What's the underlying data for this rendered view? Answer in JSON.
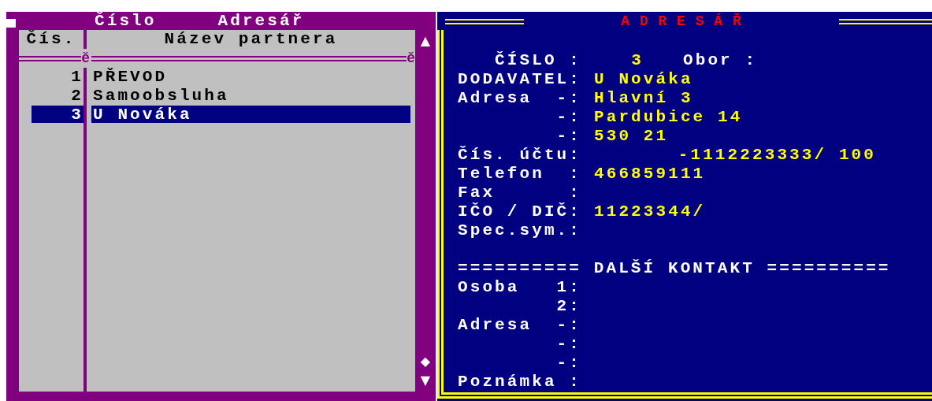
{
  "left_panel": {
    "titles": [
      "Číslo",
      "Adresář"
    ],
    "columns": [
      "Čís.",
      "Název partnera"
    ],
    "separator_marks": [
      "ě",
      "ě"
    ],
    "rows": [
      {
        "number": "1",
        "name": "PŘEVOD",
        "selected": false
      },
      {
        "number": "2",
        "name": "Samoobsluha",
        "selected": false
      },
      {
        "number": "3",
        "name": "U Nováka",
        "selected": true
      }
    ],
    "scrollbar": {
      "up": "▲",
      "thumb": "◆",
      "down": "▼"
    }
  },
  "right_panel": {
    "title": "A D R E S Á Ř",
    "fields": [
      {
        "kind": "number",
        "label": "ČÍSLO :",
        "value": "3",
        "extra_label": "Obor :"
      },
      {
        "kind": "text",
        "label": "DODAVATEL:",
        "value": "U Nováka"
      },
      {
        "kind": "text",
        "label": "Adresa  -:",
        "value": "Hlavní 3"
      },
      {
        "kind": "text",
        "label": "-:",
        "value": "Pardubice 14"
      },
      {
        "kind": "text",
        "label": "-:",
        "value": "530 21"
      },
      {
        "kind": "account",
        "label": "Čís. účtu:",
        "value": "-1112223333/ 100"
      },
      {
        "kind": "text",
        "label": "Telefon  :",
        "value": "466859111"
      },
      {
        "kind": "text",
        "label": "Fax      :"
      },
      {
        "kind": "text",
        "label": "IČO / DIČ:",
        "value": "11223344/"
      },
      {
        "kind": "text",
        "label": "Spec.sym.:"
      }
    ],
    "section_title": "========== DALŠÍ KONTAKT ==========",
    "contact_fields": [
      {
        "label": "Osoba   1:"
      },
      {
        "label": "2:"
      },
      {
        "label": "Adresa  -:"
      },
      {
        "label": "-:"
      },
      {
        "label": "-:"
      },
      {
        "label": "Poznámka :"
      }
    ]
  }
}
